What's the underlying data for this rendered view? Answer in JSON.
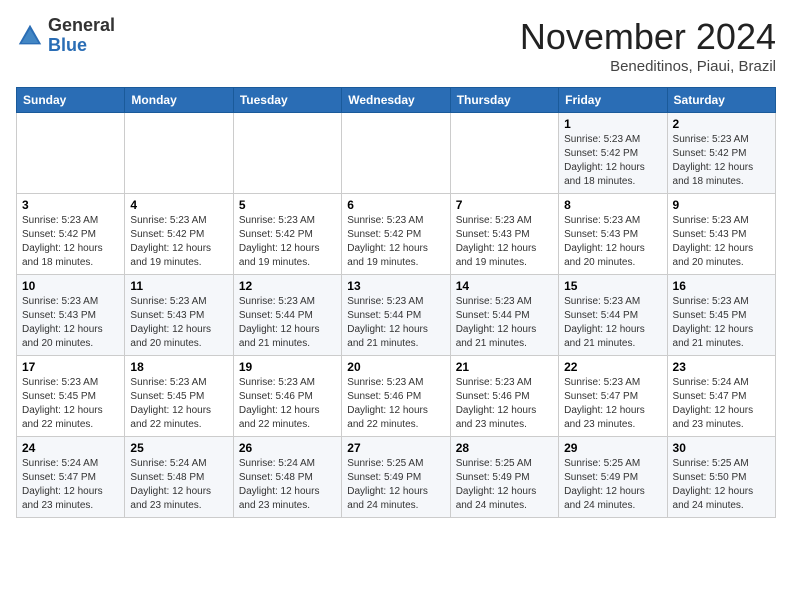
{
  "header": {
    "logo_general": "General",
    "logo_blue": "Blue",
    "month_title": "November 2024",
    "location": "Beneditinos, Piaui, Brazil"
  },
  "weekdays": [
    "Sunday",
    "Monday",
    "Tuesday",
    "Wednesday",
    "Thursday",
    "Friday",
    "Saturday"
  ],
  "weeks": [
    [
      {
        "day": "",
        "info": ""
      },
      {
        "day": "",
        "info": ""
      },
      {
        "day": "",
        "info": ""
      },
      {
        "day": "",
        "info": ""
      },
      {
        "day": "",
        "info": ""
      },
      {
        "day": "1",
        "info": "Sunrise: 5:23 AM\nSunset: 5:42 PM\nDaylight: 12 hours\nand 18 minutes."
      },
      {
        "day": "2",
        "info": "Sunrise: 5:23 AM\nSunset: 5:42 PM\nDaylight: 12 hours\nand 18 minutes."
      }
    ],
    [
      {
        "day": "3",
        "info": "Sunrise: 5:23 AM\nSunset: 5:42 PM\nDaylight: 12 hours\nand 18 minutes."
      },
      {
        "day": "4",
        "info": "Sunrise: 5:23 AM\nSunset: 5:42 PM\nDaylight: 12 hours\nand 19 minutes."
      },
      {
        "day": "5",
        "info": "Sunrise: 5:23 AM\nSunset: 5:42 PM\nDaylight: 12 hours\nand 19 minutes."
      },
      {
        "day": "6",
        "info": "Sunrise: 5:23 AM\nSunset: 5:42 PM\nDaylight: 12 hours\nand 19 minutes."
      },
      {
        "day": "7",
        "info": "Sunrise: 5:23 AM\nSunset: 5:43 PM\nDaylight: 12 hours\nand 19 minutes."
      },
      {
        "day": "8",
        "info": "Sunrise: 5:23 AM\nSunset: 5:43 PM\nDaylight: 12 hours\nand 20 minutes."
      },
      {
        "day": "9",
        "info": "Sunrise: 5:23 AM\nSunset: 5:43 PM\nDaylight: 12 hours\nand 20 minutes."
      }
    ],
    [
      {
        "day": "10",
        "info": "Sunrise: 5:23 AM\nSunset: 5:43 PM\nDaylight: 12 hours\nand 20 minutes."
      },
      {
        "day": "11",
        "info": "Sunrise: 5:23 AM\nSunset: 5:43 PM\nDaylight: 12 hours\nand 20 minutes."
      },
      {
        "day": "12",
        "info": "Sunrise: 5:23 AM\nSunset: 5:44 PM\nDaylight: 12 hours\nand 21 minutes."
      },
      {
        "day": "13",
        "info": "Sunrise: 5:23 AM\nSunset: 5:44 PM\nDaylight: 12 hours\nand 21 minutes."
      },
      {
        "day": "14",
        "info": "Sunrise: 5:23 AM\nSunset: 5:44 PM\nDaylight: 12 hours\nand 21 minutes."
      },
      {
        "day": "15",
        "info": "Sunrise: 5:23 AM\nSunset: 5:44 PM\nDaylight: 12 hours\nand 21 minutes."
      },
      {
        "day": "16",
        "info": "Sunrise: 5:23 AM\nSunset: 5:45 PM\nDaylight: 12 hours\nand 21 minutes."
      }
    ],
    [
      {
        "day": "17",
        "info": "Sunrise: 5:23 AM\nSunset: 5:45 PM\nDaylight: 12 hours\nand 22 minutes."
      },
      {
        "day": "18",
        "info": "Sunrise: 5:23 AM\nSunset: 5:45 PM\nDaylight: 12 hours\nand 22 minutes."
      },
      {
        "day": "19",
        "info": "Sunrise: 5:23 AM\nSunset: 5:46 PM\nDaylight: 12 hours\nand 22 minutes."
      },
      {
        "day": "20",
        "info": "Sunrise: 5:23 AM\nSunset: 5:46 PM\nDaylight: 12 hours\nand 22 minutes."
      },
      {
        "day": "21",
        "info": "Sunrise: 5:23 AM\nSunset: 5:46 PM\nDaylight: 12 hours\nand 23 minutes."
      },
      {
        "day": "22",
        "info": "Sunrise: 5:23 AM\nSunset: 5:47 PM\nDaylight: 12 hours\nand 23 minutes."
      },
      {
        "day": "23",
        "info": "Sunrise: 5:24 AM\nSunset: 5:47 PM\nDaylight: 12 hours\nand 23 minutes."
      }
    ],
    [
      {
        "day": "24",
        "info": "Sunrise: 5:24 AM\nSunset: 5:47 PM\nDaylight: 12 hours\nand 23 minutes."
      },
      {
        "day": "25",
        "info": "Sunrise: 5:24 AM\nSunset: 5:48 PM\nDaylight: 12 hours\nand 23 minutes."
      },
      {
        "day": "26",
        "info": "Sunrise: 5:24 AM\nSunset: 5:48 PM\nDaylight: 12 hours\nand 23 minutes."
      },
      {
        "day": "27",
        "info": "Sunrise: 5:25 AM\nSunset: 5:49 PM\nDaylight: 12 hours\nand 24 minutes."
      },
      {
        "day": "28",
        "info": "Sunrise: 5:25 AM\nSunset: 5:49 PM\nDaylight: 12 hours\nand 24 minutes."
      },
      {
        "day": "29",
        "info": "Sunrise: 5:25 AM\nSunset: 5:49 PM\nDaylight: 12 hours\nand 24 minutes."
      },
      {
        "day": "30",
        "info": "Sunrise: 5:25 AM\nSunset: 5:50 PM\nDaylight: 12 hours\nand 24 minutes."
      }
    ]
  ]
}
